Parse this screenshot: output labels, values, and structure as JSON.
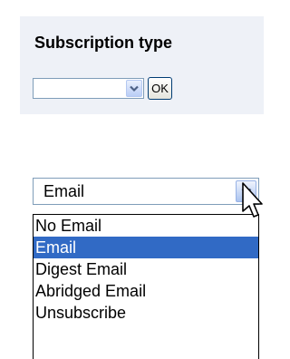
{
  "panel": {
    "title": "Subscription type",
    "select_value": "",
    "ok_label": "OK"
  },
  "dropdown": {
    "current_value": "Email",
    "options": [
      {
        "label": "No Email",
        "selected": false
      },
      {
        "label": "Email",
        "selected": true
      },
      {
        "label": "Digest Email",
        "selected": false
      },
      {
        "label": "Abridged Email",
        "selected": false
      },
      {
        "label": "Unsubscribe",
        "selected": false
      }
    ]
  },
  "colors": {
    "panel_bg": "#eef1f7",
    "highlight": "#316ac5",
    "field_border": "#7f9db9"
  },
  "icons": [
    "chevron-down-icon",
    "mouse-pointer-icon"
  ]
}
